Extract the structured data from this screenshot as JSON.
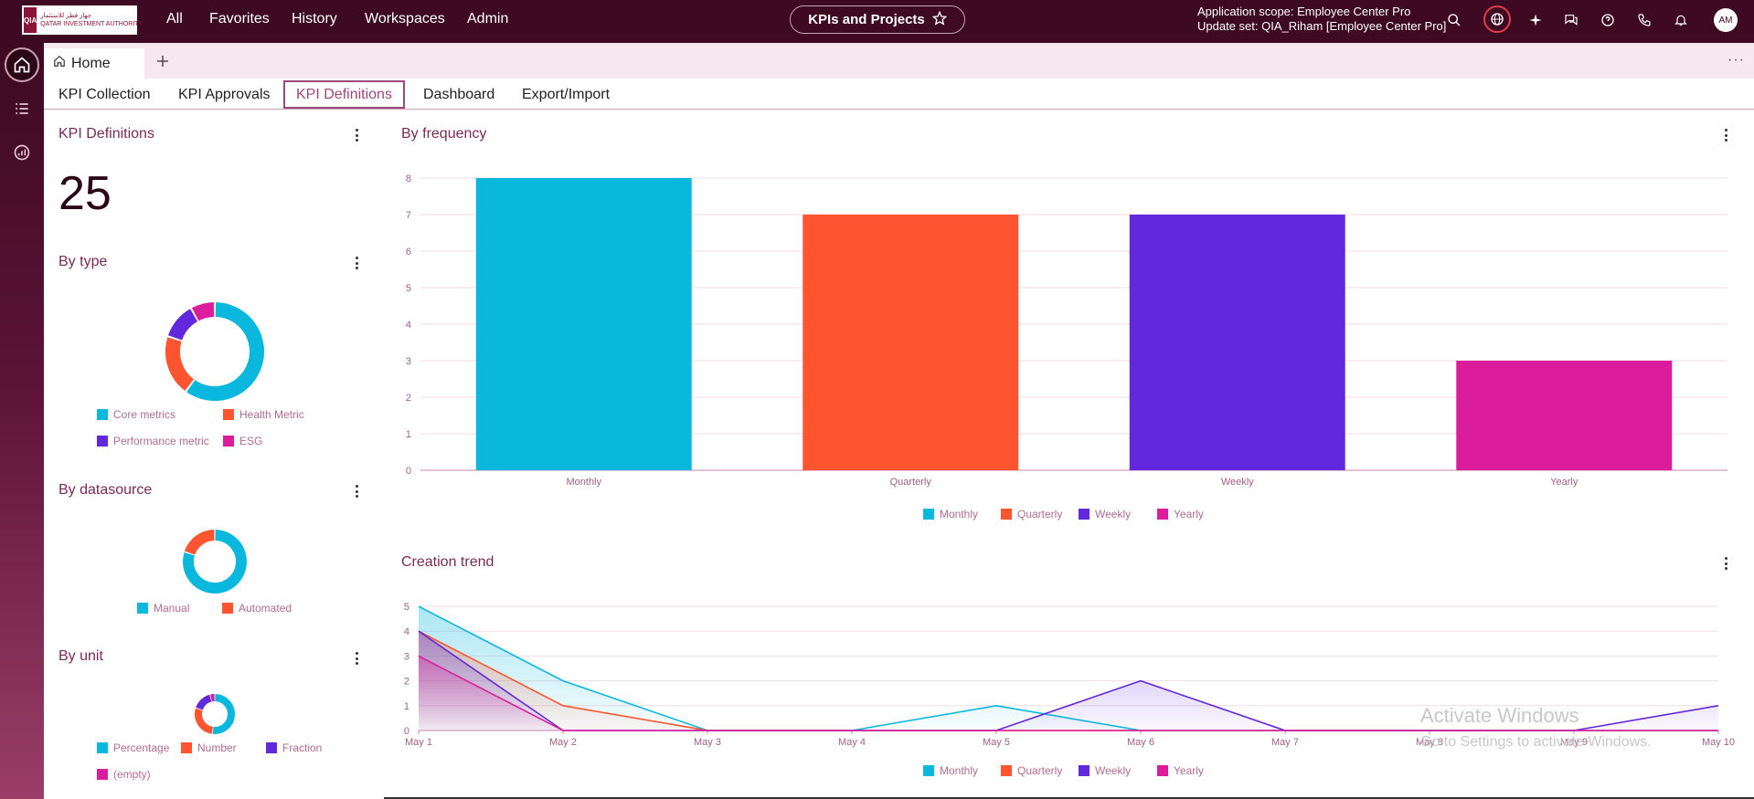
{
  "logo": {
    "mark": "QIA",
    "text_ar": "جهاز قطر للاستثمار",
    "text_en": "QATAR INVESTMENT AUTHORITY"
  },
  "topnav": {
    "items": [
      "All",
      "Favorites",
      "History",
      "Workspaces",
      "Admin"
    ]
  },
  "center_pill": {
    "label": "KPIs and Projects"
  },
  "scope": {
    "app_scope": "Application scope: Employee Center Pro",
    "update_set": "Update set: QIA_Riham [Employee Center Pro]"
  },
  "avatar": {
    "initials": "AM"
  },
  "tabstrip": {
    "home_label": "Home",
    "more": "···"
  },
  "subtabs": {
    "items": [
      "KPI Collection",
      "KPI Approvals",
      "KPI Definitions",
      "Dashboard",
      "Export/Import"
    ],
    "active": "KPI Definitions"
  },
  "widgets": {
    "kpi_definitions": {
      "title": "KPI Definitions",
      "count": "25"
    },
    "by_type": {
      "title": "By type",
      "legend": [
        "Core metrics",
        "Health Metric",
        "Performance metric",
        "ESG"
      ]
    },
    "by_datasource": {
      "title": "By datasource",
      "legend": [
        "Manual",
        "Automated"
      ]
    },
    "by_unit": {
      "title": "By unit",
      "legend": [
        "Percentage",
        "Number",
        "Fraction",
        "(empty)"
      ]
    },
    "by_frequency": {
      "title": "By frequency"
    },
    "creation_trend": {
      "title": "Creation trend"
    }
  },
  "colors": {
    "cyan": "#0bb8dd",
    "orange": "#fe5530",
    "purple": "#6229dc",
    "magenta": "#dc1d9b",
    "topbar": "#3d0a22",
    "accent": "#a0477a"
  },
  "chart_data": [
    {
      "type": "pie",
      "title": "By type",
      "categories": [
        "Core metrics",
        "Health Metric",
        "Performance metric",
        "ESG"
      ],
      "values": [
        15,
        5,
        3,
        2
      ]
    },
    {
      "type": "pie",
      "title": "By datasource",
      "categories": [
        "Manual",
        "Automated"
      ],
      "values": [
        20,
        5
      ]
    },
    {
      "type": "pie",
      "title": "By unit",
      "categories": [
        "Percentage",
        "Number",
        "Fraction",
        "(empty)"
      ],
      "values": [
        13,
        7,
        4,
        1
      ]
    },
    {
      "type": "bar",
      "title": "By frequency",
      "categories": [
        "Monthly",
        "Quarterly",
        "Weekly",
        "Yearly"
      ],
      "values": [
        8,
        7,
        7,
        3
      ],
      "ylim": [
        0,
        8
      ],
      "yticks": [
        "0",
        "1",
        "2",
        "3",
        "4",
        "5",
        "6",
        "7",
        "8"
      ],
      "legend": [
        "Monthly",
        "Quarterly",
        "Weekly",
        "Yearly"
      ],
      "legend_position": "bottom"
    },
    {
      "type": "area",
      "title": "Creation trend",
      "x": [
        "May 1",
        "May 2",
        "May 3",
        "May 4",
        "May 5",
        "May 6",
        "May 7",
        "May 8",
        "May 9",
        "May 10"
      ],
      "series": [
        {
          "name": "Monthly",
          "values": [
            5,
            2,
            0,
            0,
            1,
            0,
            0,
            0,
            0,
            0
          ]
        },
        {
          "name": "Quarterly",
          "values": [
            4,
            1,
            0,
            0,
            0,
            0,
            0,
            0,
            0,
            0
          ]
        },
        {
          "name": "Weekly",
          "values": [
            4,
            0,
            0,
            0,
            0,
            2,
            0,
            0,
            0,
            1
          ]
        },
        {
          "name": "Yearly",
          "values": [
            3,
            0,
            0,
            0,
            0,
            0,
            0,
            0,
            0,
            0
          ]
        }
      ],
      "ylim": [
        0,
        5
      ],
      "yticks": [
        "0",
        "1",
        "2",
        "3",
        "4",
        "5"
      ],
      "legend_position": "bottom"
    }
  ],
  "watermark": {
    "line1": "Activate Windows",
    "line2": "Go to Settings to activate Windows."
  }
}
